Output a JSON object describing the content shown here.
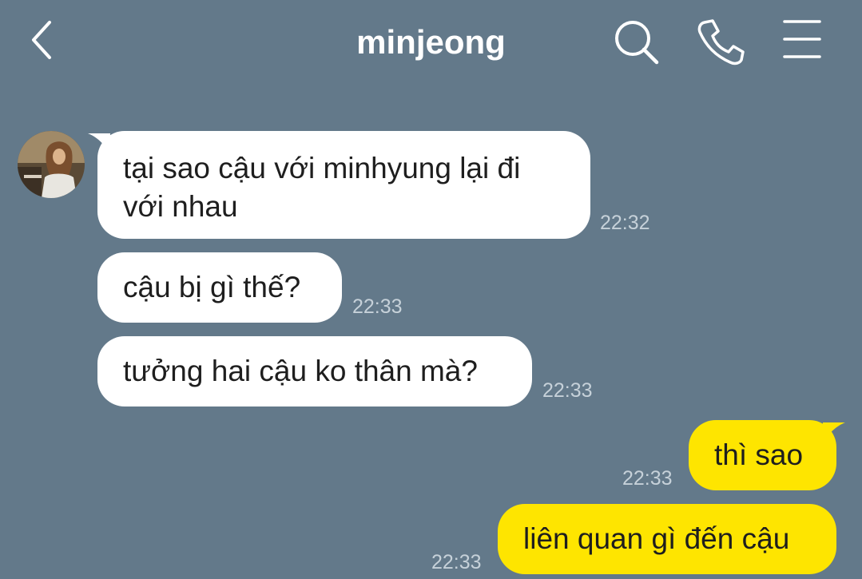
{
  "header": {
    "title": "minjeong",
    "back_icon": "chevron-left-icon",
    "search_icon": "search-icon",
    "call_icon": "phone-icon",
    "menu_icon": "menu-icon"
  },
  "colors": {
    "background": "#63798a",
    "incoming_bubble": "#ffffff",
    "outgoing_bubble": "#fee500",
    "timestamp": "#c6d1d9"
  },
  "messages": [
    {
      "sender": "minjeong",
      "text": "tại sao cậu với minhyung lại đi với nhau",
      "time": "22:32"
    },
    {
      "sender": "minjeong",
      "text": "cậu bị gì thế?",
      "time": "22:33"
    },
    {
      "sender": "minjeong",
      "text": "tưởng hai cậu ko thân mà?",
      "time": "22:33"
    },
    {
      "sender": "me",
      "text": "thì sao",
      "time": "22:33"
    },
    {
      "sender": "me",
      "text": "liên quan gì đến cậu",
      "time": "22:33"
    }
  ]
}
